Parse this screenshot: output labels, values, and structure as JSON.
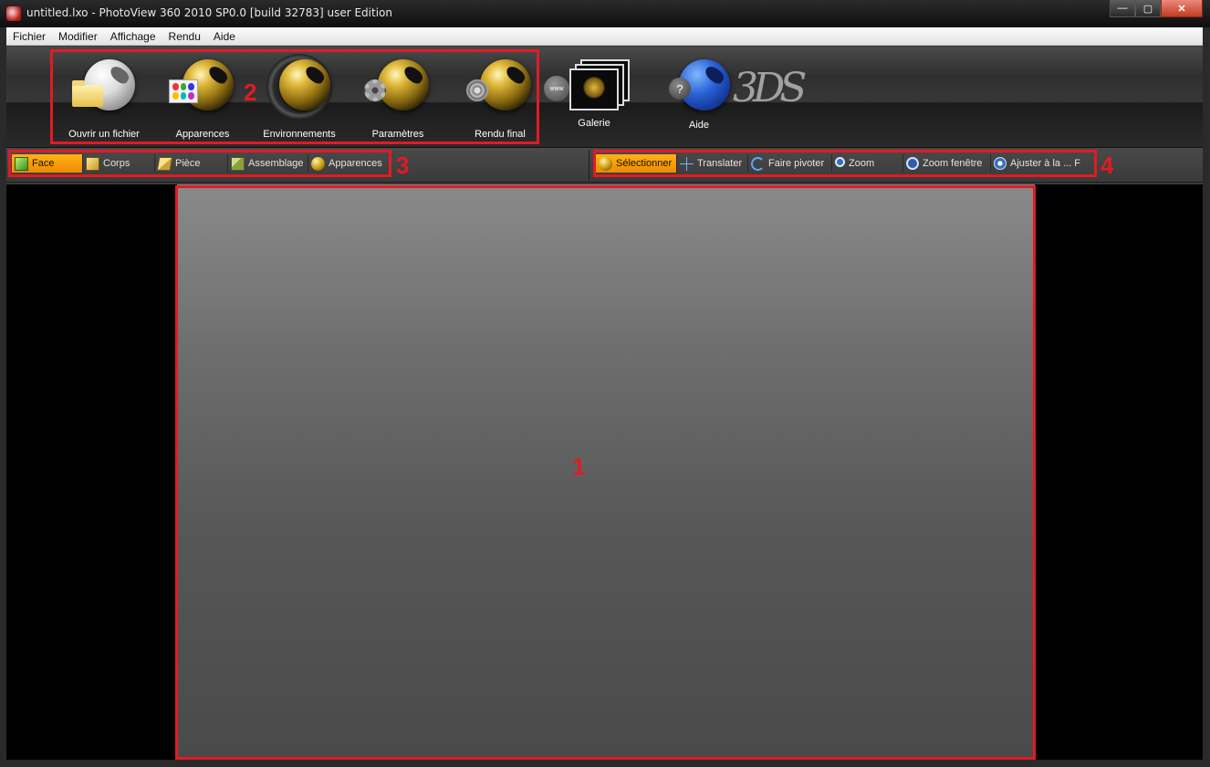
{
  "window": {
    "title": "untitled.lxo - PhotoView 360 2010 SP0.0 [build 32783] user Edition",
    "controls": {
      "minimize": "—",
      "maximize": "▢",
      "close": "✕"
    }
  },
  "menu": [
    "Fichier",
    "Modifier",
    "Affichage",
    "Rendu",
    "Aide"
  ],
  "ribbon": {
    "open_file": "Ouvrir un fichier",
    "appearances": "Apparences",
    "environments": "Environnements",
    "settings": "Paramètres",
    "final_render": "Rendu final",
    "gallery": "Galerie",
    "gallery_badge": "www",
    "help": "Aide",
    "help_badge": "?",
    "logo": "3DS"
  },
  "selection_filter": [
    {
      "label": "Face",
      "icon": "face-cube-icon",
      "active": true
    },
    {
      "label": "Corps",
      "icon": "body-cube-icon",
      "active": false
    },
    {
      "label": "Pièce",
      "icon": "part-icon",
      "active": false
    },
    {
      "label": "Assemblage",
      "icon": "assembly-icon",
      "active": false
    },
    {
      "label": "Apparences",
      "icon": "appearance-ball-icon",
      "active": false
    }
  ],
  "view_tools": [
    {
      "label": "Sélectionner",
      "icon": "select-icon",
      "active": true
    },
    {
      "label": "Translater",
      "icon": "translate-icon",
      "active": false
    },
    {
      "label": "Faire pivoter",
      "icon": "rotate-icon",
      "active": false
    },
    {
      "label": "Zoom",
      "icon": "zoom-icon",
      "active": false
    },
    {
      "label": "Zoom fenêtre",
      "icon": "zoom-window-icon",
      "active": false
    },
    {
      "label": "Ajuster à la ... F",
      "icon": "fit-icon",
      "active": false
    }
  ],
  "annotations": {
    "viewport": "1",
    "ribbon": "2",
    "filters": "3",
    "tools": "4"
  },
  "colors": {
    "annotation": "#e01b24",
    "active_button": "#f5a000"
  }
}
